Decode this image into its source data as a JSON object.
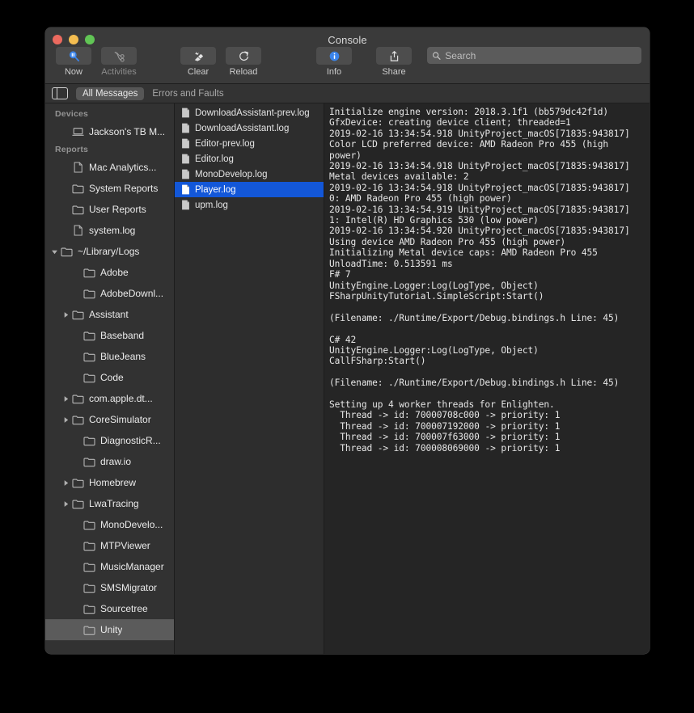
{
  "window": {
    "title": "Console",
    "traffic_lights": [
      "close-button",
      "minimize-button",
      "maximize-button"
    ]
  },
  "toolbar": {
    "items": [
      {
        "id": "now",
        "label": "Now",
        "icon": "pause-search-icon",
        "active": true
      },
      {
        "id": "activities",
        "label": "Activities",
        "icon": "activities-icon",
        "active": false
      },
      {
        "id": "clear",
        "label": "Clear",
        "icon": "clear-icon",
        "active": false
      },
      {
        "id": "reload",
        "label": "Reload",
        "icon": "reload-icon",
        "active": false
      },
      {
        "id": "info",
        "label": "Info",
        "icon": "info-icon",
        "active": false
      },
      {
        "id": "share",
        "label": "Share",
        "icon": "share-icon",
        "active": false
      }
    ],
    "search": {
      "placeholder": "Search",
      "value": "",
      "icon": "search-icon"
    }
  },
  "filterbar": {
    "sidebar_toggle_icon": "sidebar-toggle-icon",
    "tabs": [
      {
        "label": "All Messages",
        "active": true
      },
      {
        "label": "Errors and Faults",
        "active": false
      }
    ]
  },
  "sidebar": {
    "sections": [
      {
        "header": "Devices",
        "items": [
          {
            "label": "Jackson's TB M...",
            "icon": "laptop-icon",
            "indent": 1,
            "twisty": "none",
            "selected": false
          }
        ]
      },
      {
        "header": "Reports",
        "items": [
          {
            "label": "Mac Analytics...",
            "icon": "document-icon",
            "indent": 1,
            "twisty": "none",
            "selected": false
          },
          {
            "label": "System Reports",
            "icon": "folder-icon",
            "indent": 1,
            "twisty": "none",
            "selected": false
          },
          {
            "label": "User Reports",
            "icon": "folder-icon",
            "indent": 1,
            "twisty": "none",
            "selected": false
          },
          {
            "label": "system.log",
            "icon": "document-icon",
            "indent": 1,
            "twisty": "none",
            "selected": false
          },
          {
            "label": "~/Library/Logs",
            "icon": "folder-icon",
            "indent": 0,
            "twisty": "down",
            "selected": false
          },
          {
            "label": "Adobe",
            "icon": "folder-icon",
            "indent": 2,
            "twisty": "none",
            "selected": false
          },
          {
            "label": "AdobeDownl...",
            "icon": "folder-icon",
            "indent": 2,
            "twisty": "none",
            "selected": false
          },
          {
            "label": "Assistant",
            "icon": "folder-icon",
            "indent": 1,
            "twisty": "right",
            "selected": false
          },
          {
            "label": "Baseband",
            "icon": "folder-icon",
            "indent": 2,
            "twisty": "none",
            "selected": false
          },
          {
            "label": "BlueJeans",
            "icon": "folder-icon",
            "indent": 2,
            "twisty": "none",
            "selected": false
          },
          {
            "label": "Code",
            "icon": "folder-icon",
            "indent": 2,
            "twisty": "none",
            "selected": false
          },
          {
            "label": "com.apple.dt...",
            "icon": "folder-icon",
            "indent": 1,
            "twisty": "right",
            "selected": false
          },
          {
            "label": "CoreSimulator",
            "icon": "folder-icon",
            "indent": 1,
            "twisty": "right",
            "selected": false
          },
          {
            "label": "DiagnosticR...",
            "icon": "folder-icon",
            "indent": 2,
            "twisty": "none",
            "selected": false
          },
          {
            "label": "draw.io",
            "icon": "folder-icon",
            "indent": 2,
            "twisty": "none",
            "selected": false
          },
          {
            "label": "Homebrew",
            "icon": "folder-icon",
            "indent": 1,
            "twisty": "right",
            "selected": false
          },
          {
            "label": "LwaTracing",
            "icon": "folder-icon",
            "indent": 1,
            "twisty": "right",
            "selected": false
          },
          {
            "label": "MonoDevelo...",
            "icon": "folder-icon",
            "indent": 2,
            "twisty": "none",
            "selected": false
          },
          {
            "label": "MTPViewer",
            "icon": "folder-icon",
            "indent": 2,
            "twisty": "none",
            "selected": false
          },
          {
            "label": "MusicManager",
            "icon": "folder-icon",
            "indent": 2,
            "twisty": "none",
            "selected": false
          },
          {
            "label": "SMSMigrator",
            "icon": "folder-icon",
            "indent": 2,
            "twisty": "none",
            "selected": false
          },
          {
            "label": "Sourcetree",
            "icon": "folder-icon",
            "indent": 2,
            "twisty": "none",
            "selected": false
          },
          {
            "label": "Unity",
            "icon": "folder-icon",
            "indent": 2,
            "twisty": "none",
            "selected": true
          }
        ]
      }
    ]
  },
  "filelist": {
    "items": [
      {
        "label": "DownloadAssistant-prev.log",
        "icon": "log-file-icon",
        "selected": false
      },
      {
        "label": "DownloadAssistant.log",
        "icon": "log-file-icon",
        "selected": false
      },
      {
        "label": "Editor-prev.log",
        "icon": "log-file-icon",
        "selected": false
      },
      {
        "label": "Editor.log",
        "icon": "log-file-icon",
        "selected": false
      },
      {
        "label": "MonoDevelop.log",
        "icon": "log-file-icon",
        "selected": false
      },
      {
        "label": "Player.log",
        "icon": "log-file-icon",
        "selected": true
      },
      {
        "label": "upm.log",
        "icon": "log-file-icon",
        "selected": false
      }
    ]
  },
  "log": {
    "content": "Initialize engine version: 2018.3.1f1 (bb579dc42f1d)\nGfxDevice: creating device client; threaded=1\n2019-02-16 13:34:54.918 UnityProject_macOS[71835:943817] Color LCD preferred device: AMD Radeon Pro 455 (high power)\n2019-02-16 13:34:54.918 UnityProject_macOS[71835:943817] Metal devices available: 2\n2019-02-16 13:34:54.918 UnityProject_macOS[71835:943817] 0: AMD Radeon Pro 455 (high power)\n2019-02-16 13:34:54.919 UnityProject_macOS[71835:943817] 1: Intel(R) HD Graphics 530 (low power)\n2019-02-16 13:34:54.920 UnityProject_macOS[71835:943817] Using device AMD Radeon Pro 455 (high power)\nInitializing Metal device caps: AMD Radeon Pro 455\nUnloadTime: 0.513591 ms\nF# 7\nUnityEngine.Logger:Log(LogType, Object)\nFSharpUnityTutorial.SimpleScript:Start()\n\n(Filename: ./Runtime/Export/Debug.bindings.h Line: 45)\n\nC# 42\nUnityEngine.Logger:Log(LogType, Object)\nCallFSharp:Start()\n\n(Filename: ./Runtime/Export/Debug.bindings.h Line: 45)\n\nSetting up 4 worker threads for Enlighten.\n  Thread -> id: 70000708c000 -> priority: 1\n  Thread -> id: 700007192000 -> priority: 1\n  Thread -> id: 700007f63000 -> priority: 1\n  Thread -> id: 700008069000 -> priority: 1\n"
  },
  "colors": {
    "selection_blue": "#1357d8",
    "window_bg": "#2b2b2b",
    "toolbar_bg": "#3a3a3a",
    "sidebar_bg": "#323232",
    "log_bg": "#252525",
    "accent_icon_blue": "#3b84ea"
  }
}
